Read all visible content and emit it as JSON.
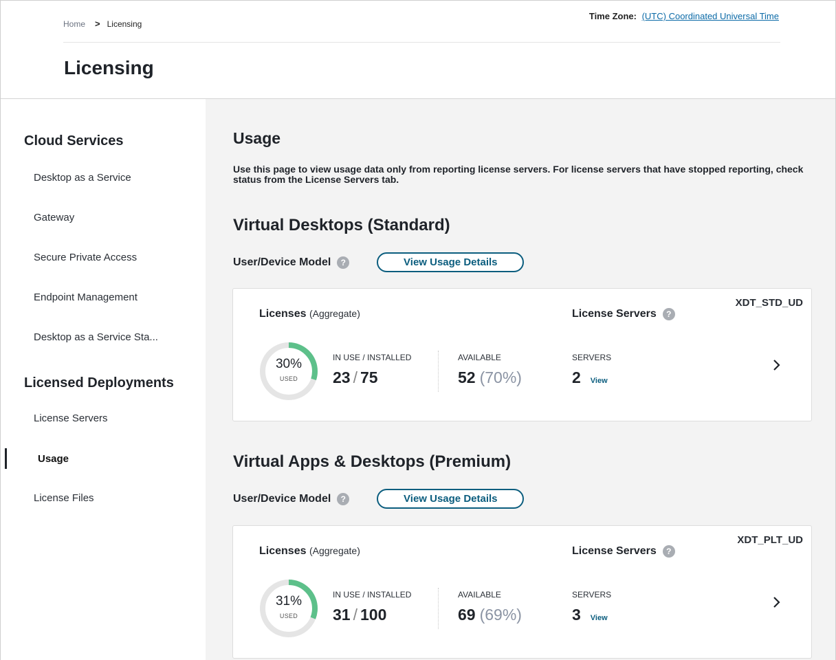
{
  "breadcrumb": {
    "home": "Home",
    "separator": ">",
    "current": "Licensing"
  },
  "timezone": {
    "label": "Time Zone:",
    "value": "(UTC) Coordinated Universal Time"
  },
  "page_title": "Licensing",
  "sidebar": {
    "groups": [
      "Cloud Services",
      "Licensed Deployments"
    ],
    "cloud_items": [
      "Desktop as a Service",
      "Gateway",
      "Secure Private Access",
      "Endpoint Management",
      "Desktop as a Service Sta..."
    ],
    "deployment_items": [
      "License Servers",
      "Usage",
      "License Files"
    ],
    "active_item": "Usage"
  },
  "main": {
    "title": "Usage",
    "description": "Use this page to view usage data only from reporting license servers. For license servers that have stopped reporting, check status from the License Servers tab.",
    "sections": [
      {
        "title": "Virtual Desktops (Standard)",
        "model": "User/Device Model",
        "button": "View Usage Details",
        "card": {
          "code": "XDT_STD_UD",
          "licenses_title": "Licenses",
          "licenses_sub": "(Aggregate)",
          "servers_title": "License Servers",
          "used_pct": "30%",
          "used_fraction": 0.3,
          "used_label": "USED",
          "inuse_label": "IN USE  /  INSTALLED",
          "in_use": "23",
          "slash": "/",
          "installed": "75",
          "available_label": "AVAILABLE",
          "available": "52",
          "available_pct": "(70%)",
          "servers_label": "SERVERS",
          "servers": "2",
          "view_link": "View"
        }
      },
      {
        "title": "Virtual Apps & Desktops (Premium)",
        "model": "User/Device Model",
        "button": "View Usage Details",
        "card": {
          "code": "XDT_PLT_UD",
          "licenses_title": "Licenses",
          "licenses_sub": "(Aggregate)",
          "servers_title": "License Servers",
          "used_pct": "31%",
          "used_fraction": 0.31,
          "used_label": "USED",
          "inuse_label": "IN USE  /  INSTALLED",
          "in_use": "31",
          "slash": "/",
          "installed": "100",
          "available_label": "AVAILABLE",
          "available": "69",
          "available_pct": "(69%)",
          "servers_label": "SERVERS",
          "servers": "3",
          "view_link": "View"
        }
      }
    ]
  },
  "colors": {
    "donut_fill": "#5dc08a",
    "donut_track": "#e5e5e5",
    "accent": "#0b5d7e"
  }
}
